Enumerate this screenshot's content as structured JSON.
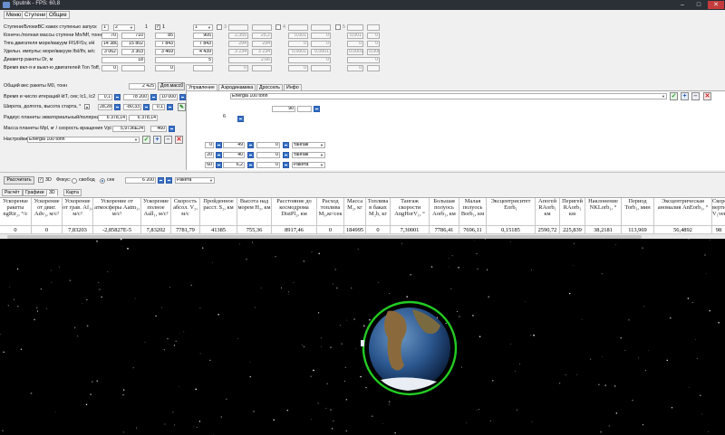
{
  "window": {
    "title": "Sputnik - FPS: 60,8"
  },
  "menu": {
    "items": [
      "Меню",
      "Ступени",
      "Общие"
    ]
  },
  "left": {
    "stage_count_label": "Ступени/БлокиВС каких ступенью запуск",
    "stage_count_v1": "1",
    "stage_count_v2": "2",
    "stage_count_v3": "1",
    "cols": [
      "1",
      "2",
      "3",
      "4",
      "5"
    ],
    "rows": [
      {
        "label": "Конечн./полная массы ступени Mn/Mf, тонн",
        "vals": [
          "70",
          "710",
          "85",
          "905",
          "2,355",
          "25,2",
          "0,001",
          "0",
          "0,001",
          "0"
        ]
      },
      {
        "label": "Тяга двигателя море/вакуум Ff1/Ff1v, кН",
        "vals": [
          "14 380",
          "15 802",
          "7 843",
          "7 843",
          "294",
          "294",
          "0",
          "0",
          "0",
          "0"
        ]
      },
      {
        "label": "Удельн. импульс море/вакуум Ifsl/Ifv, м/с",
        "vals": [
          "3 062",
          "3 303",
          "3 469",
          "4 439",
          "3 234",
          "3 234",
          "0,0001",
          "0,0001",
          "0,0001",
          "0,0001"
        ]
      },
      {
        "label": "Диаметр ракеты Dr, м",
        "vals": [
          "18",
          "5",
          "2,66",
          "0",
          "0"
        ]
      },
      {
        "label": "Время вкл-я и выкл-ю двигателей Ton Toff, сек",
        "vals": [
          "0",
          "0",
          "0",
          "0",
          "0"
        ]
      }
    ],
    "total_mass_label": "Общий вес ракеты M0, тонн",
    "total_mass": "2 425",
    "total_mass_btn": "Доп.масс0",
    "iter_label": "Время и число итераций ktT, сек; lc1, lc2",
    "iter_v1": "0,1",
    "iter_v2": "78 200",
    "iter_v3": "10 000",
    "lat_label": "Широта, долгота, высота старта, °",
    "lat_v1": "28,28",
    "lat_v2": "-80,33",
    "lat_v3": "0,1",
    "radius_label": "Радиус планеты экваториальный/полярный Rpl, км",
    "radius_v1": "6 378,14",
    "radius_v2": "6 378,14",
    "pmass_label": "Масса планеты Mpl, кг / скорость вращения Vpl м/с",
    "pmass_v1": "5,9736E24",
    "pmass_v2": "460",
    "settings_label": "Настройки",
    "settings_value": "Energia 100 tonn"
  },
  "right": {
    "tabs": [
      "Управление",
      "Аэродинамика",
      "Дроссель",
      "Инфо"
    ],
    "preset": "Energia 100 tonn",
    "v_90": "90",
    "v_6": "6",
    "rows": [
      {
        "a": "0",
        "b": "49",
        "c": "0",
        "mode": "тангаж"
      },
      {
        "a": "20",
        "b": "40",
        "c": "0",
        "mode": "тангаж"
      },
      {
        "a": "60",
        "b": "6,2",
        "c": "0",
        "mode": "Ракета"
      }
    ]
  },
  "controls": {
    "calc_button": "Рассчитать",
    "check_3d": "3D",
    "focus_label": "Фокус:",
    "radio_free": "свобод",
    "radio_sec": "сек",
    "sec_value": "6 200",
    "target": "Ракета"
  },
  "result_tabs": [
    "Расчёт",
    "Графики",
    "3D",
    "Карта"
  ],
  "table": {
    "headers": [
      "Ускоренue ракеты ngRir₂, °/с",
      "Ускорение от двиг. Adv₁, м/с²",
      "Ускорение от грав. Af₁, м/с²",
      "Ускорение от атмосферы Aatm₁, м/с²",
      "Ускорение полное Aall₁, м/с²",
      "Скорость абсол. V₂, м/с",
      "Пройденное расст. S₂, км",
      "Высота над морем H₂, км",
      "Расстояние до космодрома DistPl₂, км",
      "Расход топлива M₃,кг/сек",
      "Масса M₂, кг",
      "Топлива в баках M₂b, кг",
      "Тангаж скорости AngHorV₁, °",
      "Большая полуось Aorb₁, км",
      "Малая полуось Borb₁, км",
      "Эксцентриситет Eorb₁",
      "Апогей RAorb₁ км",
      "Перигей RAorb₁ км",
      "Наклонение NKLorb₁, °",
      "Период Torb₁, мин",
      "Эксцентрическая аномалия AnEorb₁, °",
      "Скорость вертик. V₁ver"
    ],
    "values": [
      "0",
      "0",
      "7,83203",
      "-2,85827E-5",
      "7,83202",
      "7781,79",
      "41385",
      "755,36",
      "8917,46",
      "0",
      "184995",
      "0",
      "7,30001",
      "7786,41",
      "7696,11",
      "0,15185",
      "2590,72",
      "225,839",
      "38,2181",
      "113,969",
      "56,4892",
      "98"
    ]
  },
  "colors": {
    "orbit": "#22cc22",
    "ok_green": "#2a9a2a",
    "plus_blue": "#2a5ab8",
    "delete_red": "#c81f1f"
  }
}
